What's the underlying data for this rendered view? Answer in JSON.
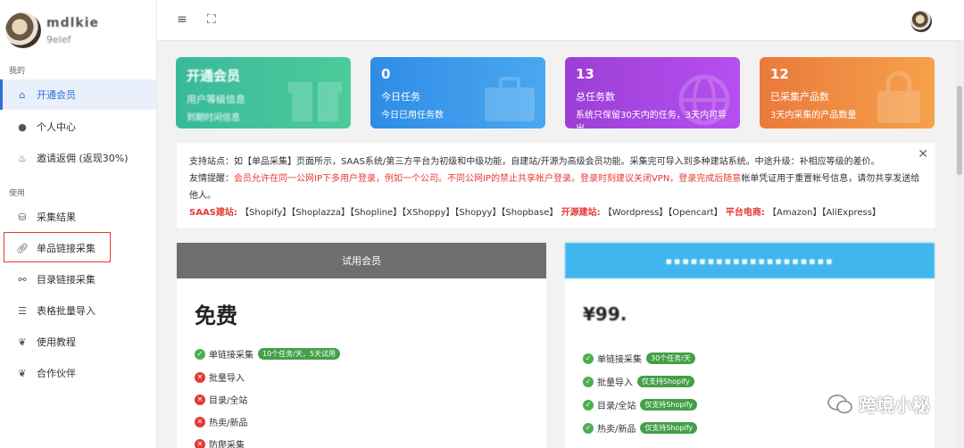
{
  "sidebar": {
    "brand_name": "mdlkie",
    "brand_sub": "9elef",
    "section_mine": "我的",
    "section_use": "使用",
    "items": [
      {
        "label": "开通会员",
        "icon": "home-icon"
      },
      {
        "label": "个人中心",
        "icon": "user-icon"
      },
      {
        "label": "邀请返佣 (返现30%)",
        "icon": "fire-icon"
      },
      {
        "label": "采集结果",
        "icon": "database-icon"
      },
      {
        "label": "单品链接采集",
        "icon": "link-icon"
      },
      {
        "label": "目录链接采集",
        "icon": "unlink-icon"
      },
      {
        "label": "表格批量导入",
        "icon": "list-icon"
      },
      {
        "label": "使用教程",
        "icon": "leaf-icon"
      },
      {
        "label": "合作伙伴",
        "icon": "leaf-icon"
      }
    ]
  },
  "topbar": {
    "menu_icon": "≡",
    "fullscreen_icon": "⛶"
  },
  "cards": [
    {
      "num": "开通会员",
      "title": "用户等级信息",
      "sub": "到期时间信息",
      "color1": "#39b99b",
      "color2": "#4ccb9b"
    },
    {
      "num": "0",
      "title": "今日任务",
      "sub": "今日已用任务数",
      "color1": "#2f8ce6",
      "color2": "#4aa8f0"
    },
    {
      "num": "13",
      "title": "总任务数",
      "sub": "系统只保留30天内的任务，3天内可导出",
      "color1": "#9c3fd6",
      "color2": "#b64ff0"
    },
    {
      "num": "12",
      "title": "已采集产品数",
      "sub": "3天内采集的产品数量",
      "color1": "#ea7a3c",
      "color2": "#f5a14a"
    }
  ],
  "notice": {
    "line1": "支持站点：如【单品采集】页面所示，SAAS系统/第三方平台为初级和中级功能，自建站/开源为高级会员功能。采集完可导入到多种建站系统。中途升级：补相应等级的差价。",
    "line2_prefix": "友情提醒：",
    "line2_red": "会员允许在同一公网IP下多用户登录，例如一个公司。不同公网IP的禁止共享帐户登录。登录时刻建议关闭VPN，登录完成后随意",
    "line2_rest": "帐单凭证用于重置帐号信息，请勿共享发送给他人。",
    "saas_label": "SAAS建站:",
    "saas_list": "【Shopify】【Shoplazza】【Shopline】【XShoppy】【Shopyy】【Shopbase】",
    "open_label": "开源建站:",
    "open_list": "【Wordpress】【Opencart】",
    "platform_label": "平台电商:",
    "platform_list": "【Amazon】【AliExpress】",
    "close": "✕"
  },
  "plans": [
    {
      "header": "试用会员",
      "name": "免费",
      "features": [
        {
          "ok": true,
          "label": "单链接采集",
          "tag": "10个任务/天，5天试用"
        },
        {
          "ok": false,
          "label": "批量导入",
          "tag": ""
        },
        {
          "ok": false,
          "label": "目录/全站",
          "tag": ""
        },
        {
          "ok": false,
          "label": "热卖/新品",
          "tag": ""
        },
        {
          "ok": false,
          "label": "防爬采集",
          "tag": ""
        }
      ]
    },
    {
      "header": "▪▪▪▪▪▪▪▪▪▪▪▪▪▪▪▪▪▪▪▪",
      "name": "¥99.",
      "features": [
        {
          "ok": true,
          "label": "单链接采集",
          "tag": "30个任务/天"
        },
        {
          "ok": true,
          "label": "批量导入",
          "tag": "仅支持Shopify"
        },
        {
          "ok": true,
          "label": "目录/全站",
          "tag": "仅支持Shopify"
        },
        {
          "ok": true,
          "label": "热卖/新品",
          "tag": "仅支持Shopify"
        }
      ]
    }
  ],
  "watermark": "跨境小秘"
}
